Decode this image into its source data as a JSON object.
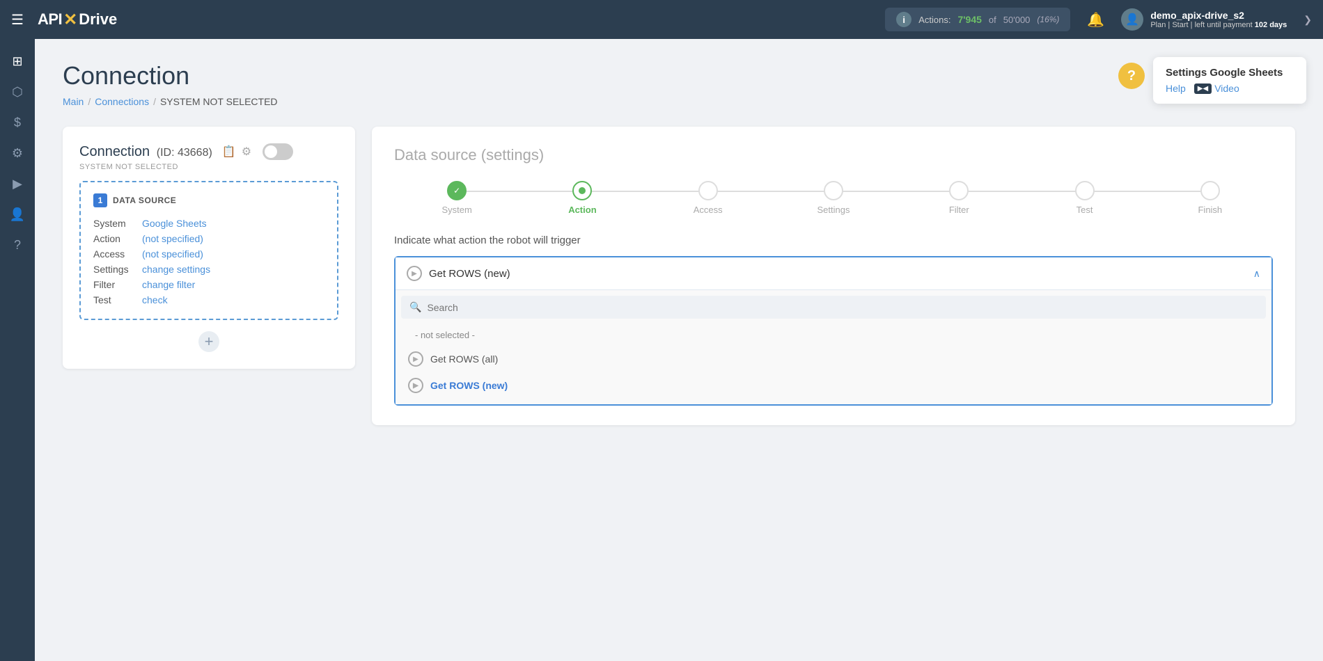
{
  "topnav": {
    "menu_icon": "☰",
    "logo_api": "API",
    "logo_x": "✕",
    "logo_drive": "Drive",
    "actions_label": "Actions:",
    "actions_count": "7'945",
    "actions_of": "of",
    "actions_total": "50'000",
    "actions_pct": "(16%)",
    "bell_icon": "🔔",
    "user_icon": "👤",
    "user_name": "demo_apix-drive_s2",
    "user_plan": "Plan",
    "user_plan_type": "Start",
    "user_left": "left until payment",
    "user_days": "102 days",
    "chevron_icon": "❯"
  },
  "sidebar": {
    "items": [
      {
        "icon": "⊞",
        "name": "dashboard"
      },
      {
        "icon": "⬡",
        "name": "connections"
      },
      {
        "icon": "$",
        "name": "billing"
      },
      {
        "icon": "⚙",
        "name": "settings"
      },
      {
        "icon": "▶",
        "name": "play"
      },
      {
        "icon": "👤",
        "name": "account"
      },
      {
        "icon": "?",
        "name": "help"
      }
    ]
  },
  "page": {
    "title": "Connection",
    "breadcrumb": {
      "main": "Main",
      "connections": "Connections",
      "current": "SYSTEM NOT SELECTED"
    }
  },
  "left_card": {
    "title": "Connection",
    "id_label": "(ID: 43668)",
    "copy_icon": "📋",
    "settings_icon": "⚙",
    "system_not_selected": "SYSTEM NOT SELECTED",
    "datasource": {
      "number": "1",
      "label": "DATA SOURCE",
      "rows": [
        {
          "key": "System",
          "value": "Google Sheets",
          "type": "link"
        },
        {
          "key": "Action",
          "value": "(not specified)",
          "type": "link"
        },
        {
          "key": "Access",
          "value": "(not specified)",
          "type": "link"
        },
        {
          "key": "Settings",
          "value": "change settings",
          "type": "link"
        },
        {
          "key": "Filter",
          "value": "change filter",
          "type": "link"
        },
        {
          "key": "Test",
          "value": "check",
          "type": "link"
        }
      ]
    },
    "add_btn": "+"
  },
  "right_card": {
    "title": "Data source",
    "title_sub": "(settings)",
    "steps": [
      {
        "label": "System",
        "state": "done"
      },
      {
        "label": "Action",
        "state": "active"
      },
      {
        "label": "Access",
        "state": "pending"
      },
      {
        "label": "Settings",
        "state": "pending"
      },
      {
        "label": "Filter",
        "state": "pending"
      },
      {
        "label": "Test",
        "state": "pending"
      },
      {
        "label": "Finish",
        "state": "pending"
      }
    ],
    "action_prompt": "Indicate what action the robot will trigger",
    "dropdown": {
      "selected_label": "Get ROWS (new)",
      "search_placeholder": "Search",
      "options": [
        {
          "label": "- not selected -",
          "type": "not-selected"
        },
        {
          "label": "Get ROWS (all)",
          "type": "normal"
        },
        {
          "label": "Get ROWS (new)",
          "type": "selected"
        }
      ]
    }
  },
  "help": {
    "question_icon": "?",
    "title": "Settings Google Sheets",
    "help_link": "Help",
    "video_link": "Video",
    "video_icon": "▶◀"
  }
}
